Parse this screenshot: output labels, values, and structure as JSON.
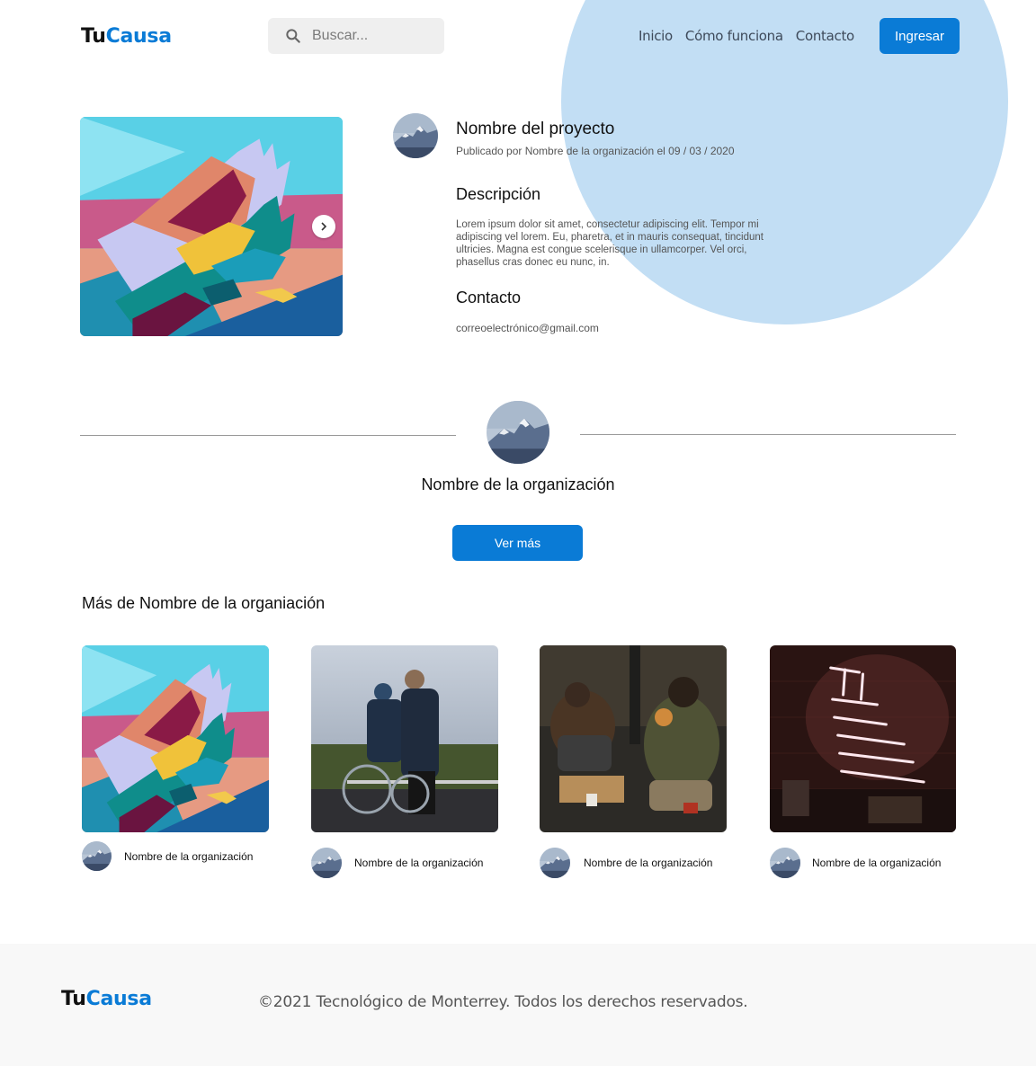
{
  "colors": {
    "accent": "#0a7bd6",
    "blob": "#c2def4",
    "footer_bg": "#f8f8f8"
  },
  "header": {
    "logo": {
      "part1": "Tu",
      "part2": "Causa"
    },
    "search": {
      "placeholder": "Buscar...",
      "icon": "search-icon"
    },
    "nav": [
      {
        "label": "Inicio"
      },
      {
        "label": "Cómo funciona"
      },
      {
        "label": "Contacto"
      }
    ],
    "login_label": "Ingresar"
  },
  "project": {
    "title": "Nombre del proyecto",
    "meta": "Publicado por Nombre de la organización el 09 / 03 / 2020",
    "description_heading": "Descripción",
    "description": "Lorem ipsum dolor sit amet, consectetur adipiscing elit. Tempor mi adipiscing vel lorem. Eu, pharetra, et in mauris consequat, tincidunt ultricies. Magna est congue scelerisque in ullamcorper. Vel orci, phasellus cras donec eu nunc, in.",
    "contact_heading": "Contacto",
    "email": "correoelectrónico@gmail.com",
    "carousel_next_icon": "chevron-right-icon"
  },
  "organization": {
    "name": "Nombre de la organización",
    "more_button": "Ver más"
  },
  "more_section": {
    "title": "Más de Nombre de la organiación",
    "cards": [
      {
        "org": "Nombre de la organización",
        "image": "painted-hands-mural"
      },
      {
        "org": "Nombre de la organización",
        "image": "wheelchair-photo"
      },
      {
        "org": "Nombre de la organización",
        "image": "homeless-sign-photo"
      },
      {
        "org": "Nombre de la organización",
        "image": "neon-sign-photo"
      }
    ]
  },
  "footer": {
    "logo": {
      "part1": "Tu",
      "part2": "Causa"
    },
    "copyright": "©2021 Tecnológico de Monterrey. Todos los derechos reservados."
  }
}
